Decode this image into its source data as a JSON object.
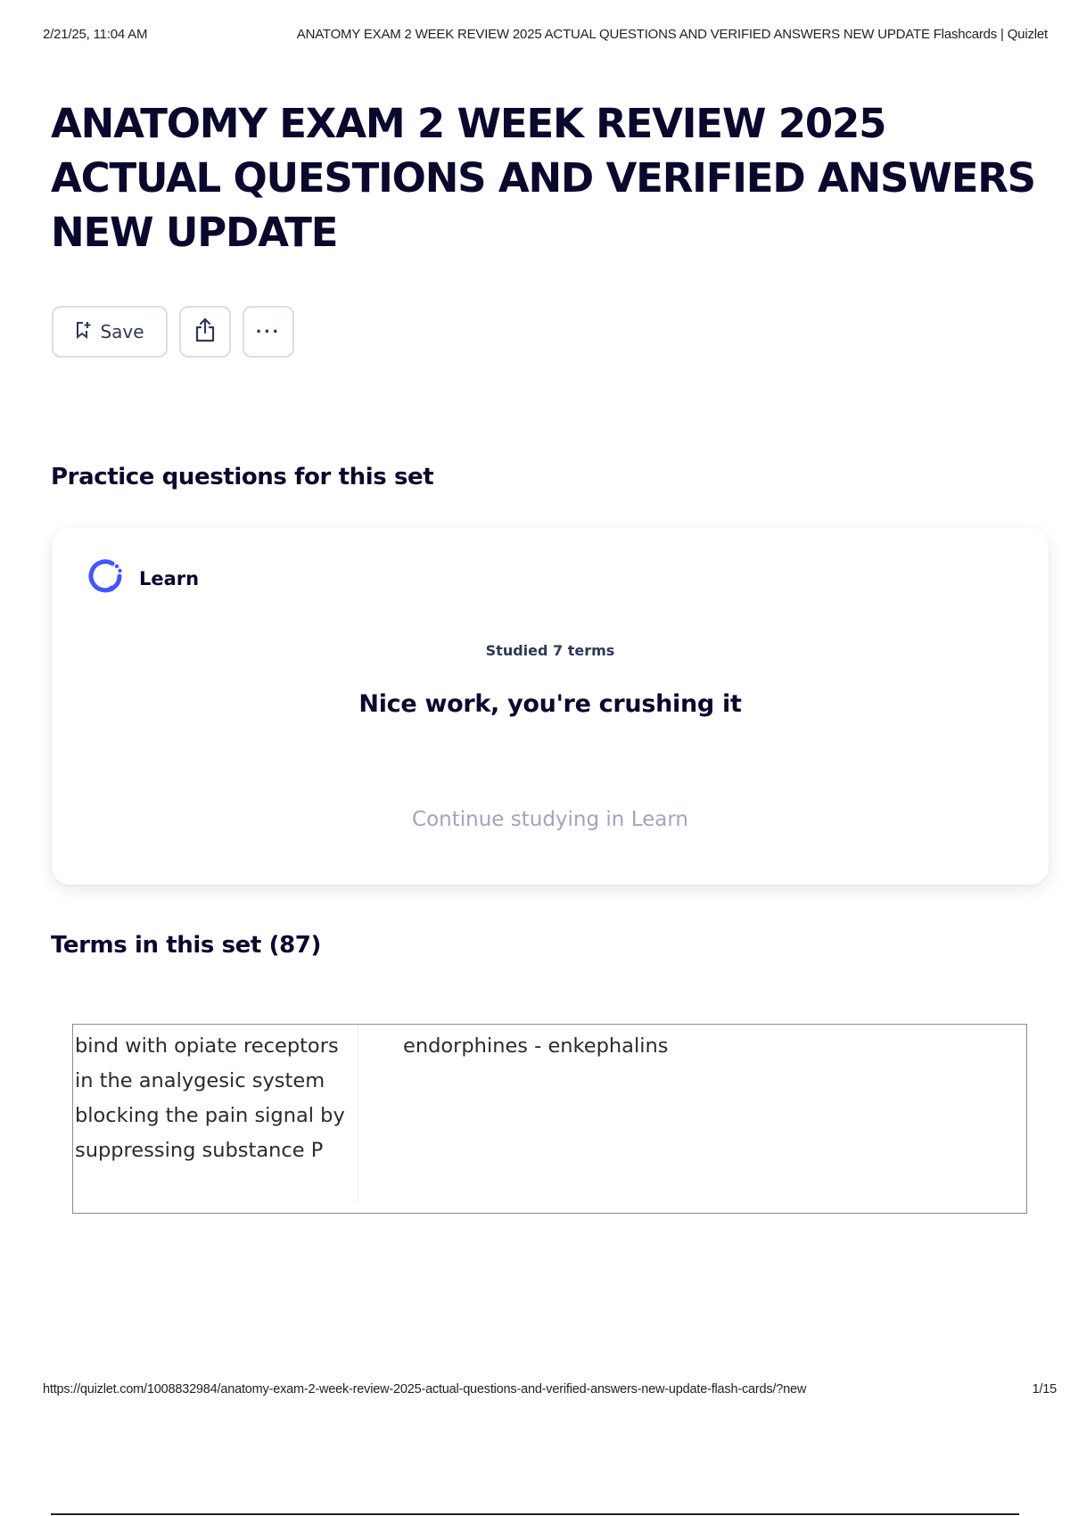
{
  "print_header": {
    "datetime": "2/21/25, 11:04 AM",
    "doc_title": "ANATOMY EXAM 2 WEEK REVIEW 2025 ACTUAL QUESTIONS AND VERIFIED ANSWERS NEW UPDATE Flashcards | Quizlet"
  },
  "set": {
    "title": "ANATOMY EXAM 2 WEEK REVIEW 2025 ACTUAL QUESTIONS AND VERIFIED ANSWERS NEW UPDATE"
  },
  "actions": {
    "save_label": "Save",
    "save_icon": "bookmark-add-icon",
    "share_icon": "share-icon",
    "more_label": "···",
    "more_icon": "more-horizontal-icon"
  },
  "practice": {
    "heading": "Practice questions for this set",
    "learn_icon": "learn-progress-icon",
    "learn_label": "Learn",
    "studied_text": "Studied 7 terms",
    "message": "Nice work, you're crushing it",
    "continue_label": "Continue studying in Learn",
    "accent_color": "#4255ff"
  },
  "terms": {
    "heading": "Terms in this set (87)",
    "rows": [
      {
        "term": "bind with opiate receptors in the analygesic system blocking the pain signal by suppressing substance P",
        "definition": "endorphines - enkephalins"
      }
    ]
  },
  "print_footer": {
    "url": "https://quizlet.com/1008832984/anatomy-exam-2-week-review-2025-actual-questions-and-verified-answers-new-update-flash-cards/?new",
    "page": "1/15"
  }
}
